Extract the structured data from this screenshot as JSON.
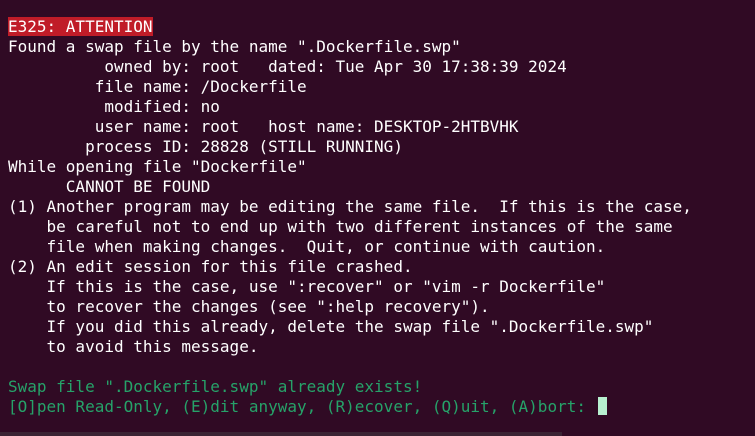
{
  "terminal": {
    "lines": [
      "E325: ATTENTION",
      "Found a swap file by the name \".Dockerfile.swp\"",
      "          owned by: root   dated: Tue Apr 30 17:38:39 2024",
      "         file name: /Dockerfile",
      "          modified: no",
      "         user name: root   host name: DESKTOP-2HTBVHK",
      "        process ID: 28828 (STILL RUNNING)",
      "While opening file \"Dockerfile\"",
      "      CANNOT BE FOUND",
      "(1) Another program may be editing the same file.  If this is the case,",
      "    be careful not to end up with two different instances of the same",
      "    file when making changes.  Quit, or continue with caution.",
      "(2) An edit session for this file crashed.",
      "    If this is the case, use \":recover\" or \"vim -r Dockerfile\"",
      "    to recover the changes (see \":help recovery\").",
      "    If you did this already, delete the swap file \".Dockerfile.swp\"",
      "    to avoid this message.",
      "",
      "Swap file \".Dockerfile.swp\" already exists!",
      "[O]pen Read-Only, (E)dit anyway, (R)ecover, (Q)uit, (A)bort: "
    ],
    "colors": {
      "background": "#300a24",
      "text": "#ffffff",
      "error_background": "#c01c28",
      "prompt_green": "#26a269",
      "cursor": "#b8f0d0"
    }
  }
}
